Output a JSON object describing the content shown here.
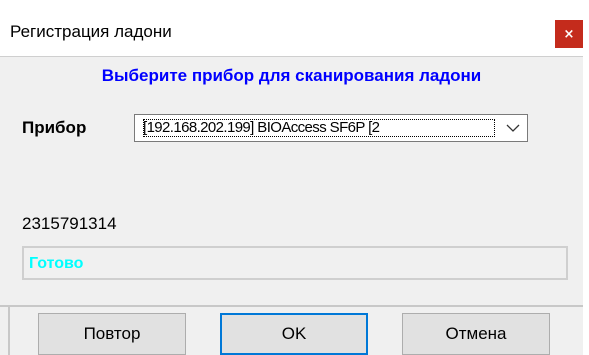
{
  "window": {
    "title": "Регистрация ладони",
    "close_label": "×"
  },
  "header": {
    "text": "Выберите прибор для сканирования ладони"
  },
  "device": {
    "label": "Прибор",
    "selected": "[192.168.202.199] BIOAccess SF6P [2"
  },
  "code": "2315791314",
  "status": {
    "text": "Готово"
  },
  "buttons": {
    "retry": "Повтор",
    "ok": "OK",
    "cancel": "Отмена"
  },
  "colors": {
    "header_text": "#0000ff",
    "status_text": "#00ffff",
    "close_bg": "#c42b1c",
    "default_button_border": "#0078d7"
  },
  "icons": {
    "close": "close-icon",
    "dropdown": "chevron-down-icon"
  }
}
